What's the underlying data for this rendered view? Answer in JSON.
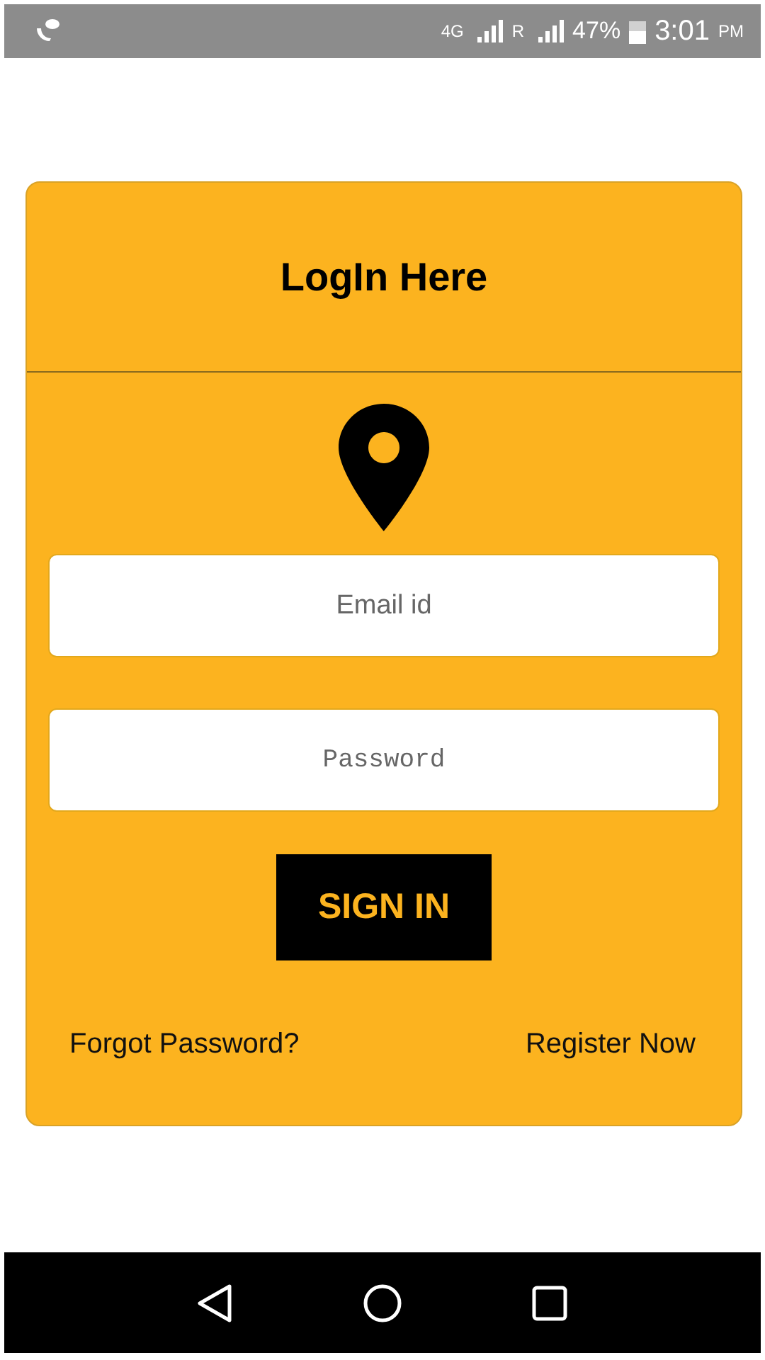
{
  "status_bar": {
    "network": "4G",
    "roaming": "R",
    "battery": "47%",
    "time": "3:01",
    "ampm": "PM"
  },
  "card": {
    "title": "LogIn Here"
  },
  "email": {
    "placeholder": "Email id"
  },
  "password": {
    "placeholder": "Password"
  },
  "sign_in": {
    "label": "SIGN IN"
  },
  "links": [
    "Forgot Password?",
    "Register Now"
  ]
}
